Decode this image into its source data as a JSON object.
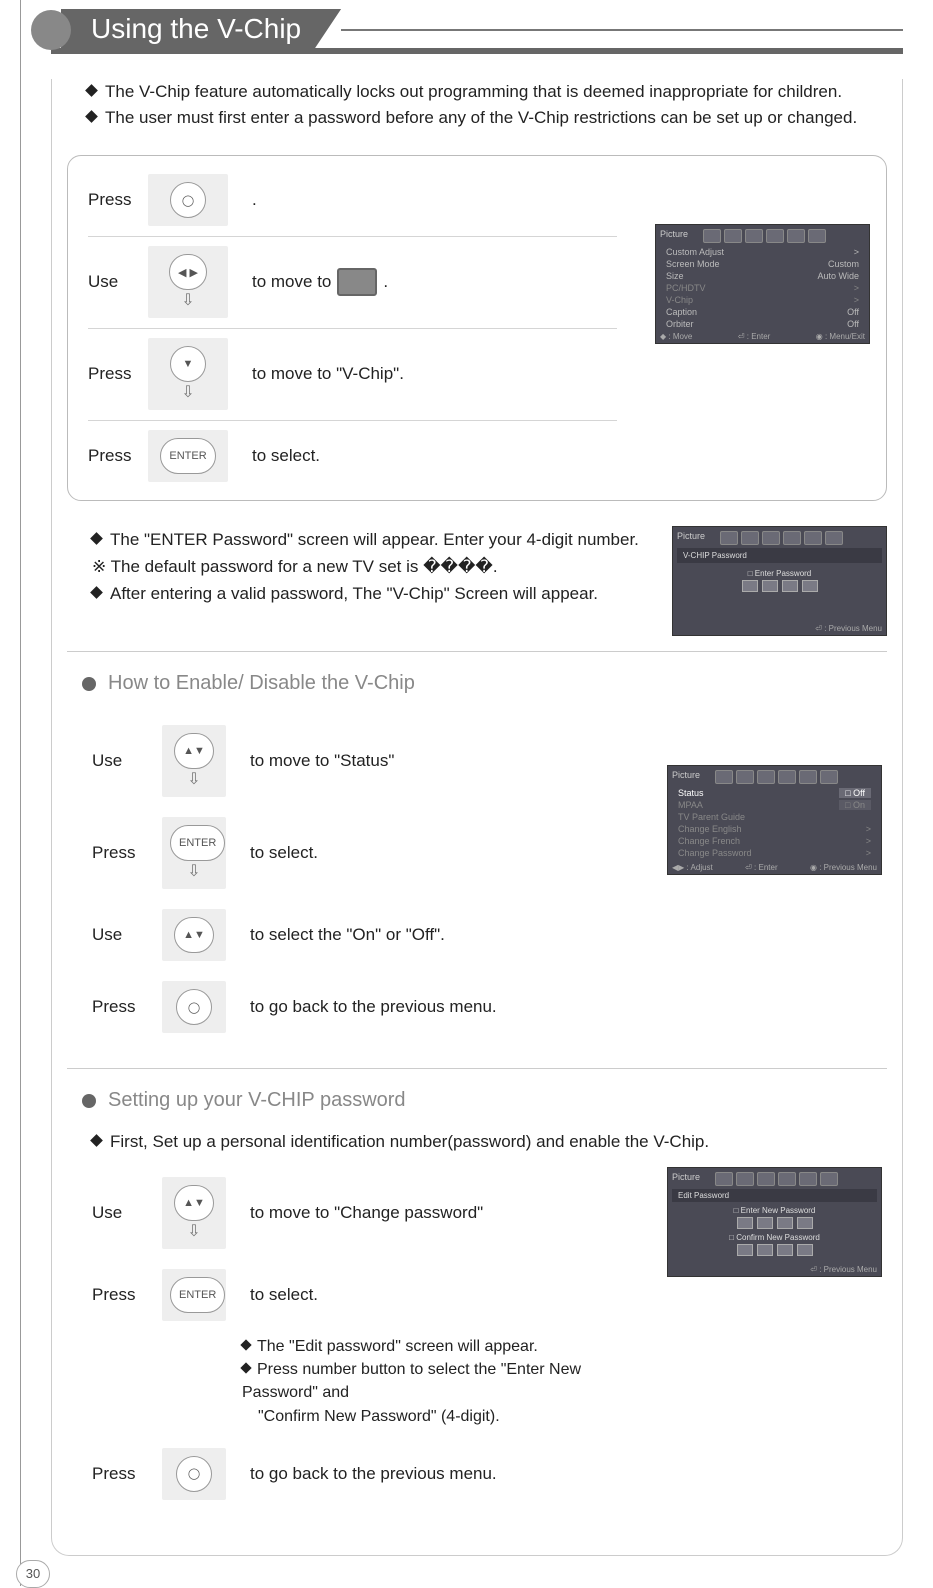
{
  "title": "Using the V-Chip",
  "pageNum": "30",
  "intro": {
    "line1": "The V-Chip feature automatically locks out programming that is deemed inappropriate for children.",
    "line2": "The user must first enter a password before any of the V-Chip restrictions can be set up or changed."
  },
  "box1": {
    "r1": {
      "label": "Press",
      "text": "."
    },
    "r2": {
      "label": "Use",
      "text1": "to move to",
      "text2": "."
    },
    "r3": {
      "label": "Press",
      "text": "to move to \"V-Chip\"."
    },
    "r4": {
      "label": "Press",
      "text": "to select."
    }
  },
  "osd1": {
    "title": "Picture",
    "rows": [
      [
        "Custom Adjust",
        ">"
      ],
      [
        "Screen Mode",
        "Custom"
      ],
      [
        "Size",
        "Auto Wide"
      ],
      [
        "PC/HDTV",
        ">"
      ],
      [
        "V-Chip",
        ">"
      ],
      [
        "Caption",
        "Off"
      ],
      [
        "Orbiter",
        "Off"
      ]
    ],
    "footer": [
      "◆ : Move",
      "⏎ : Enter",
      "◉ : Menu/Exit"
    ]
  },
  "section2": {
    "l1": "The \"ENTER Password\" screen will appear. Enter your  4-digit number.",
    "l2": "※  The default password for a new TV set is ����.",
    "l3": "After entering a valid password, The \"V-Chip\" Screen will appear."
  },
  "osd2": {
    "title": "Picture",
    "sub": "V-CHIP Password",
    "label": "□  Enter Password",
    "footer": "⏎ : Previous Menu"
  },
  "sub1": "How to Enable/ Disable the V-Chip",
  "steps3": {
    "r1": {
      "label": "Use",
      "text": "to move to \"Status\""
    },
    "r2": {
      "label": "Press",
      "text": "to select."
    },
    "r3": {
      "label": "Use",
      "text": "to select the \"On\" or \"Off\"."
    },
    "r4": {
      "label": "Press",
      "text": "to go back to the previous menu."
    }
  },
  "osd3": {
    "title": "Picture",
    "rows": [
      [
        "Status",
        "□ Off"
      ],
      [
        "MPAA",
        "□ On"
      ],
      [
        "TV Parent Guide",
        ""
      ],
      [
        "Change English",
        ">"
      ],
      [
        "Change French",
        ">"
      ],
      [
        "Change Password",
        ">"
      ]
    ],
    "footer": [
      "◀▶ : Adjust",
      "⏎ : Enter",
      "◉ : Previous Menu"
    ]
  },
  "sub2": "Setting up your V-CHIP password",
  "para2": "First, Set up a personal identification number(password) and enable the V-Chip.",
  "steps4": {
    "r1": {
      "label": "Use",
      "text": "to move to \"Change password\""
    },
    "r2": {
      "label": "Press",
      "text": "to select."
    },
    "note": {
      "l1": "The \"Edit password\" screen will appear.",
      "l2": "Press number button to select the \"Enter New Password\" and",
      "l3": "\"Confirm New Password\" (4-digit)."
    },
    "r3": {
      "label": "Press",
      "text": "to go back to the previous menu."
    }
  },
  "osd4": {
    "title": "Picture",
    "sub": "Edit Password",
    "label1": "□  Enter New Password",
    "label2": "□  Confirm New Password",
    "footer": "⏎ : Previous Menu"
  }
}
